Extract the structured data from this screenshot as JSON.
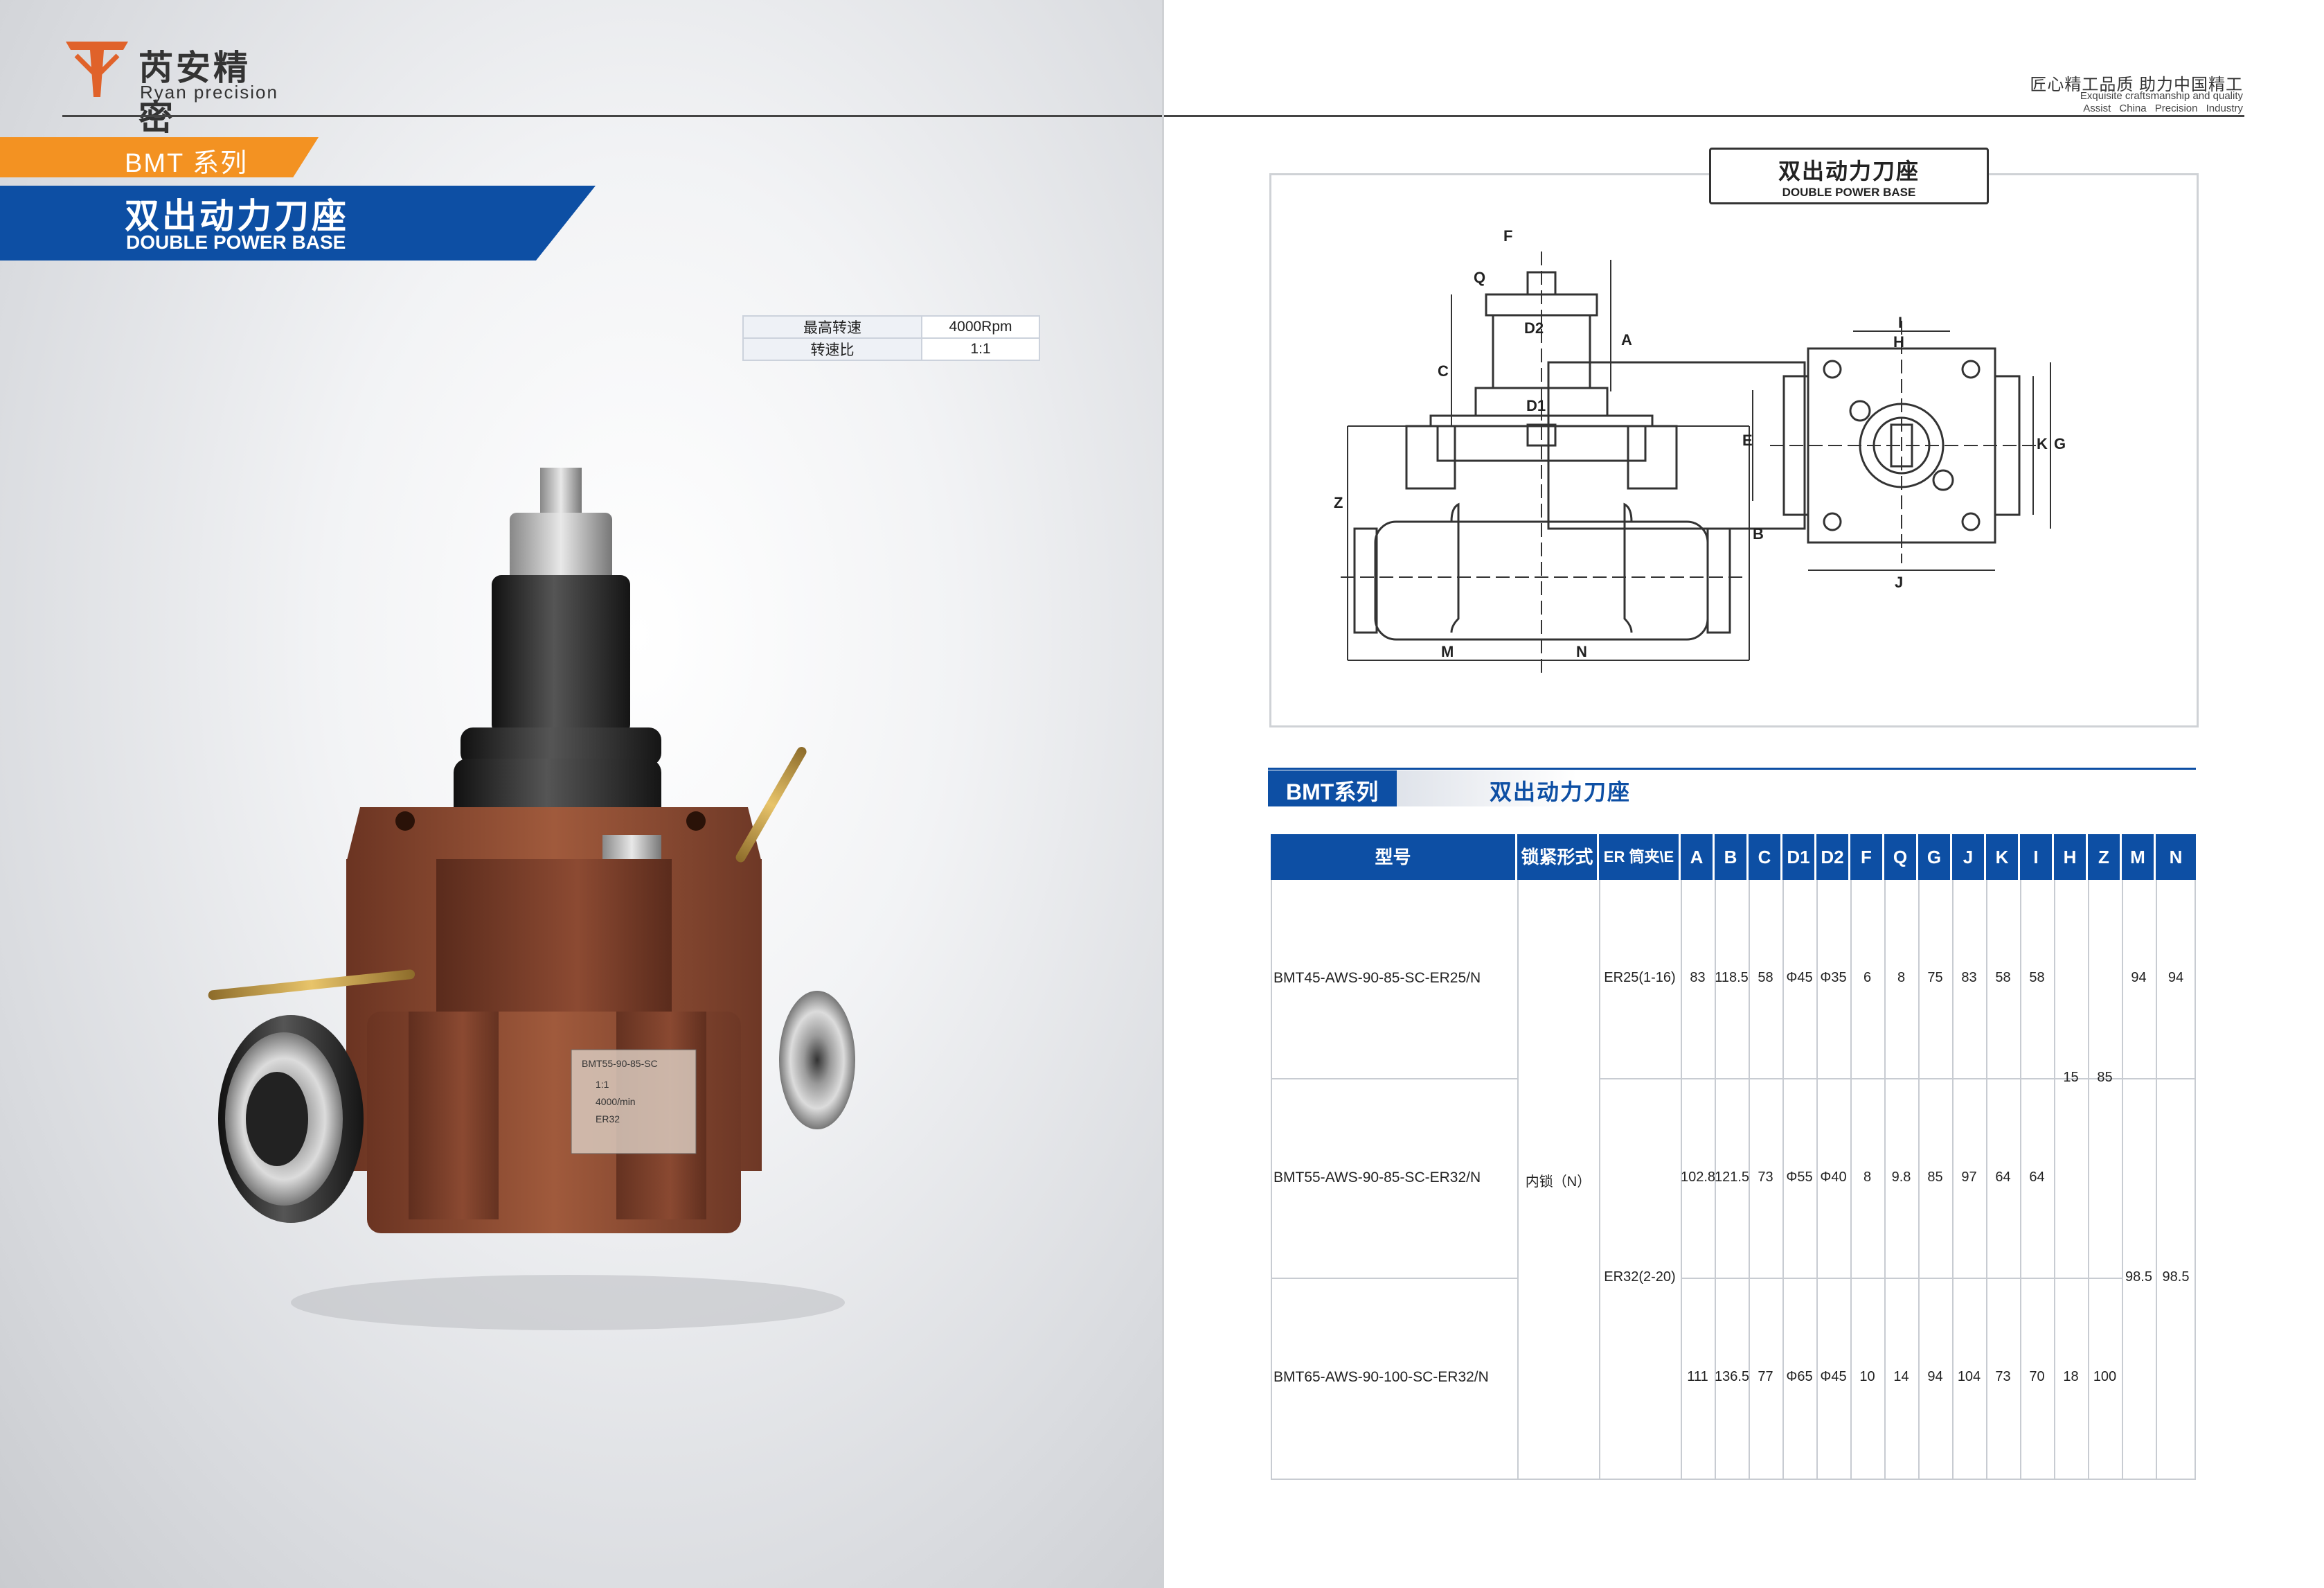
{
  "brand": {
    "name_cn": "芮安精密",
    "name_en": "Ryan precision"
  },
  "series_banner": "BMT 系列",
  "title": {
    "cn": "双出动力刀座",
    "en": "DOUBLE POWER BASE"
  },
  "spec_summary": [
    {
      "label": "最高转速",
      "value": "4000Rpm"
    },
    {
      "label": "转速比",
      "value": "1:1"
    }
  ],
  "product_nameplate": {
    "model": "BMT55-90-85-SC",
    "ratio": "1:1",
    "speed": "4000/min",
    "er": "ER32"
  },
  "tagline": {
    "cn": "匠心精工品质   助力中国精工",
    "en1": "Exquisite craftsmanship and quality",
    "en2": "Assist China Precision Industry"
  },
  "drawing": {
    "title_cn": "双出动力刀座",
    "title_en": "DOUBLE POWER BASE",
    "labels": [
      "F",
      "Q",
      "D2",
      "C",
      "A",
      "D1",
      "Z",
      "B",
      "M",
      "N",
      "I",
      "H",
      "E",
      "K",
      "G",
      "J"
    ]
  },
  "section": {
    "tab": "BMT系列",
    "title": "双出动力刀座"
  },
  "table": {
    "headers": [
      "型号",
      "锁紧形式",
      "ER 筒夹\\E",
      "A",
      "B",
      "C",
      "D1",
      "D2",
      "F",
      "Q",
      "G",
      "J",
      "K",
      "I",
      "H",
      "Z",
      "M",
      "N"
    ],
    "lock": "内锁（N）",
    "rows": [
      {
        "model": "BMT45-AWS-90-85-SC-ER25/N",
        "er": "ER25(1-16)",
        "A": "83",
        "B": "118.5",
        "C": "58",
        "D1": "Φ45",
        "D2": "Φ35",
        "F": "6",
        "Q": "8",
        "G": "75",
        "J": "83",
        "K": "58",
        "I": "58",
        "M": "94",
        "N": "94"
      },
      {
        "model": "BMT55-AWS-90-85-SC-ER32/N",
        "A": "102.8",
        "B": "121.5",
        "C": "73",
        "D1": "Φ55",
        "D2": "Φ40",
        "F": "8",
        "Q": "9.8",
        "G": "85",
        "J": "97",
        "K": "64",
        "I": "64"
      },
      {
        "model": "BMT65-AWS-90-100-SC-ER32/N",
        "A": "111",
        "B": "136.5",
        "C": "77",
        "D1": "Φ65",
        "D2": "Φ45",
        "F": "10",
        "Q": "14",
        "G": "94",
        "J": "104",
        "K": "73",
        "I": "70",
        "H": "18",
        "Z": "100"
      }
    ],
    "shared": {
      "H_12": "15",
      "Z_12": "85",
      "er_23": "ER32(2-20)",
      "M_23": "98.5",
      "N_23": "98.5"
    }
  },
  "colors": {
    "brand_blue": "#0d4fa4",
    "accent_orange": "#f39222",
    "body_copper": "#8a4a32"
  }
}
